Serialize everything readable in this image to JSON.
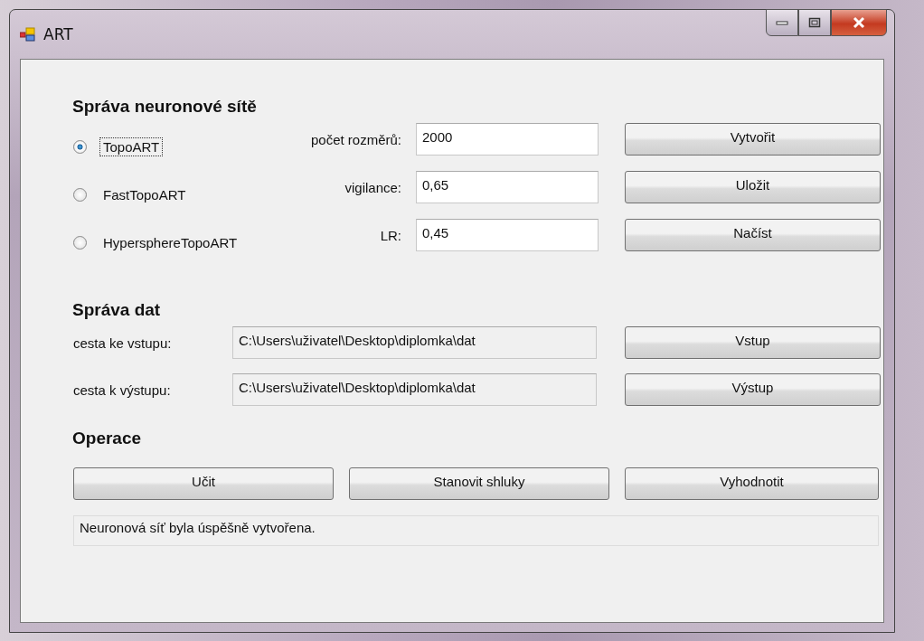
{
  "window": {
    "title": "ART"
  },
  "network": {
    "heading": "Správa neuronové sítě",
    "models": [
      {
        "label": "TopoART",
        "selected": true
      },
      {
        "label": "FastTopoART",
        "selected": false
      },
      {
        "label": "HypersphereTopoART",
        "selected": false
      }
    ],
    "params": [
      {
        "label": "počet rozměrů:",
        "value": "2000"
      },
      {
        "label": "vigilance:",
        "value": "0,65"
      },
      {
        "label": "LR:",
        "value": "0,45"
      }
    ],
    "buttons": [
      "Vytvořit",
      "Uložit",
      "Načíst"
    ]
  },
  "data": {
    "heading": "Správa dat",
    "paths": [
      {
        "label": "cesta ke vstupu:",
        "value": "C:\\Users\\uživatel\\Desktop\\diplomka\\dat",
        "button": "Vstup"
      },
      {
        "label": "cesta k výstupu:",
        "value": "C:\\Users\\uživatel\\Desktop\\diplomka\\dat",
        "button": "Výstup"
      }
    ]
  },
  "operations": {
    "heading": "Operace",
    "buttons": [
      "Učit",
      "Stanovit shluky",
      "Vyhodnotit"
    ]
  },
  "status": "Neuronová síť byla úspěšně vytvořena."
}
